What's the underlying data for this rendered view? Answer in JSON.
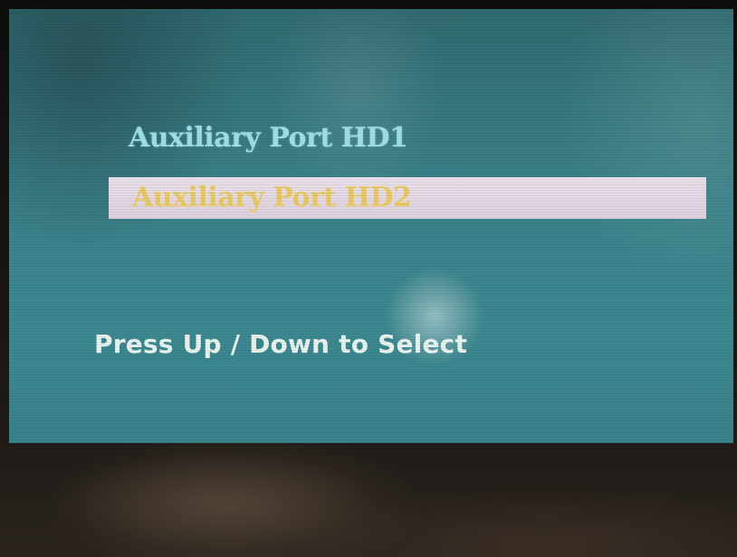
{
  "osd_menu": {
    "items": [
      {
        "label": "Auxiliary Port HD1",
        "selected": false
      },
      {
        "label": "Auxiliary Port HD2",
        "selected": true
      }
    ],
    "hint": "Press Up / Down to Select"
  },
  "colors": {
    "screen_background": "#3a8088",
    "item_text": "#9fe0e6",
    "selected_item_highlight": "#e5dce6",
    "selected_item_text": "#e8c86a",
    "hint_text": "#e8f3f0",
    "bezel": "#1a1714"
  }
}
